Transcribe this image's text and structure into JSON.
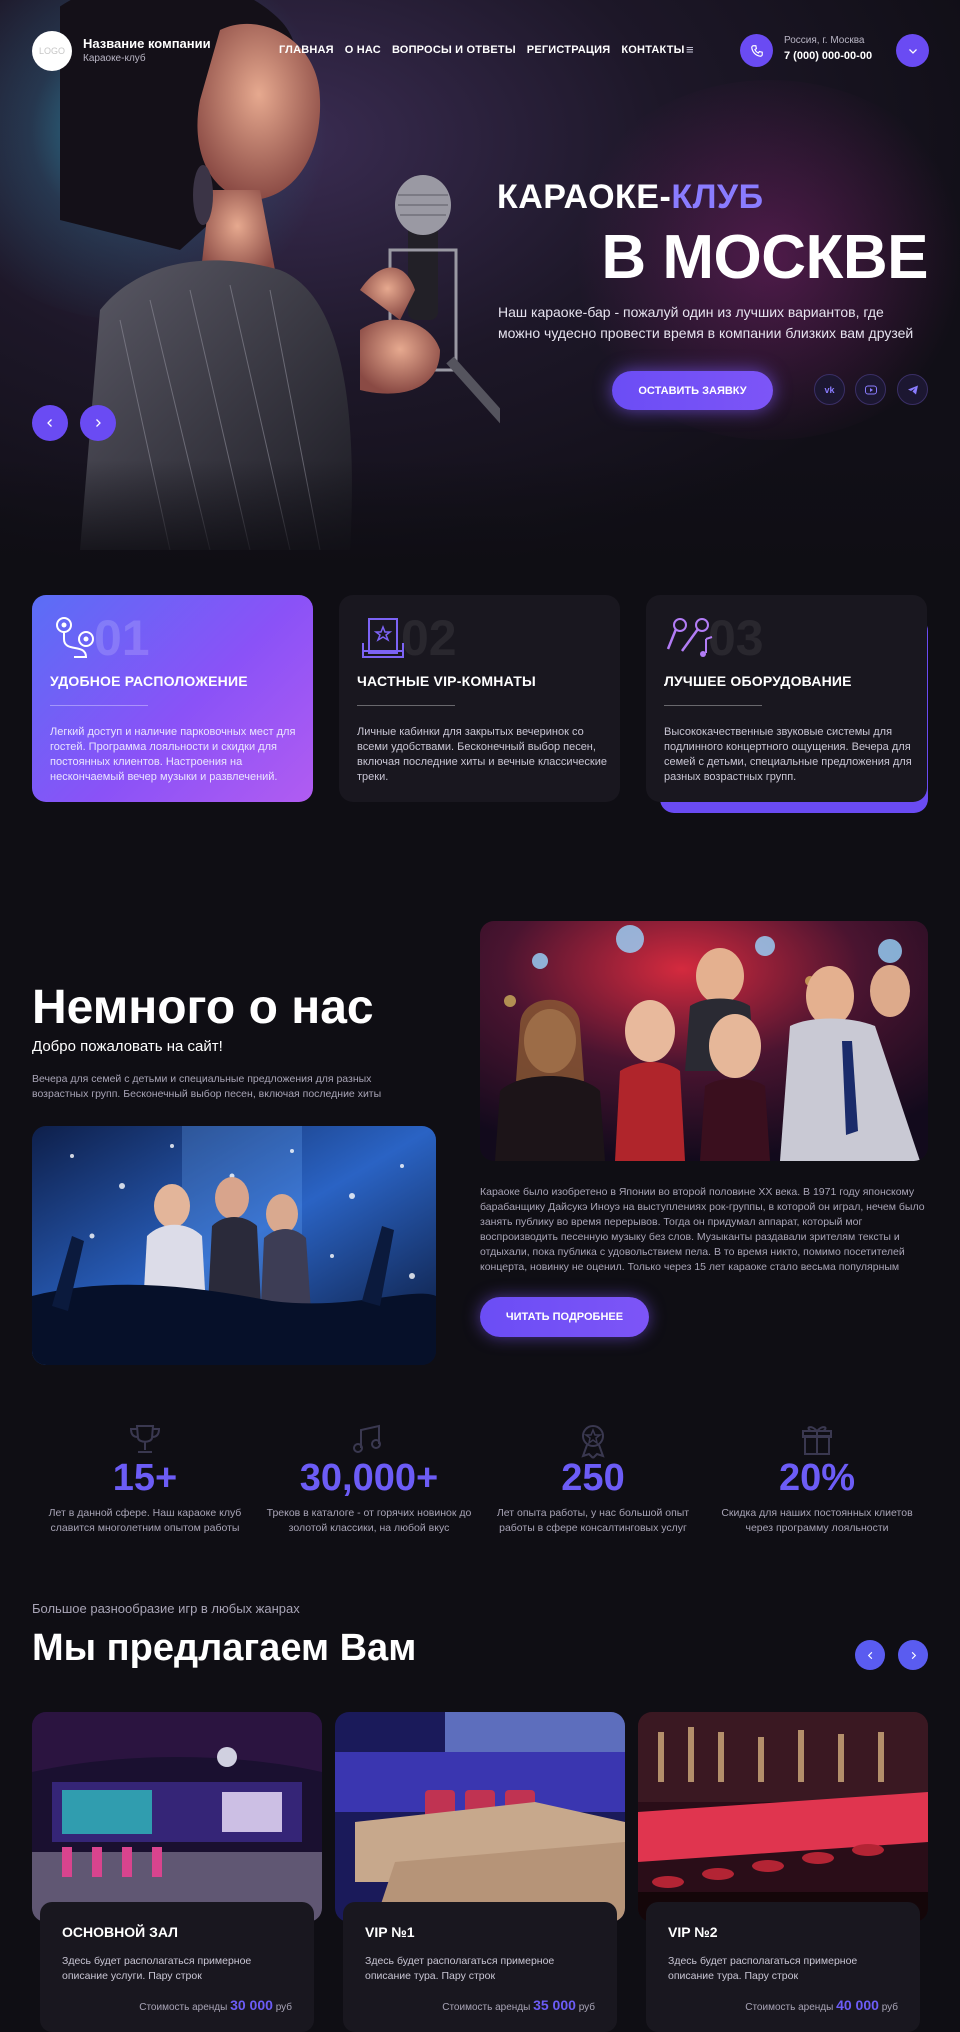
{
  "header": {
    "logo": "LOGO",
    "company": "Название компании",
    "company_sub": "Караоке-клуб",
    "nav": [
      "ГЛАВНАЯ",
      "О НАС",
      "ВОПРОСЫ И ОТВЕТЫ",
      "РЕГИСТРАЦИЯ",
      "КОНТАКТЫ"
    ],
    "menu_icon": "≡",
    "address": "Россия, г. Москва",
    "phone": "7 (000) 000-00-00"
  },
  "hero": {
    "title1_a": "КАРАОКЕ-",
    "title1_b": "КЛУБ",
    "title2": "В МОСКВЕ",
    "desc": "Наш караоке-бар - пожалуй один из лучших вариантов, где можно чудесно провести время в компании близких вам друзей",
    "cta": "ОСТАВИТЬ ЗАЯВКУ",
    "social": [
      "vk",
      "youtube",
      "telegram"
    ]
  },
  "features": [
    {
      "num": "01",
      "title": "УДОБНОЕ РАСПОЛОЖЕНИЕ",
      "text": "Легкий доступ и наличие парковочных мест для гостей. Программа лояльности и скидки для постоянных клиентов.  Настроения на нескончаемый вечер музыки и развлечений."
    },
    {
      "num": "02",
      "title": "ЧАСТНЫЕ VIP-КОМНАТЫ",
      "text": "Личные кабинки для закрытых вечеринок со всеми удобствами. Бесконечный выбор песен, включая последние хиты и вечные классические треки."
    },
    {
      "num": "03",
      "title": "ЛУЧШЕЕ ОБОРУДОВАНИЕ",
      "text": "Высококачественные звуковые системы для подлинного концертного ощущения. Вечера для семей с детьми, специальные предложения для разных возрастных групп."
    }
  ],
  "about": {
    "title": "Немного о нас",
    "subtitle": "Добро пожаловать на сайт!",
    "text1": "Вечера для семей с детьми и специальные предложения для разных возрастных групп. Бесконечный выбор песен, включая последние хиты",
    "text2": "Караоке было изобретено в Японии во второй половине XX века. В 1971 году японскому барабанщику Дайсукэ Иноуэ на выступлениях рок-группы, в которой он играл, нечем было занять публику во время перерывов. Тогда он придумал аппарат, который мог воспроизводить песенную музыку без слов. Музыканты раздавали зрителям тексты и отдыхали, пока публика с удовольствием пела. В то время никто, помимо посетителей концерта, новинку не оценил. Только через 15 лет караоке стало весьма популярным",
    "button": "ЧИТАТЬ ПОДРОБНЕЕ"
  },
  "stats": [
    {
      "value": "15+",
      "text": "Лет в данной сфере. Наш караоке клуб славится многолетним опытом работы",
      "icon": "trophy-icon"
    },
    {
      "value": "30,000+",
      "text": "Треков в каталоге - от горячих новинок до золотой классики, на любой вкус",
      "icon": "music-notes-icon"
    },
    {
      "value": "250",
      "text": "Лет опыта работы, у нас большой опыт работы в сфере консалтинговых услуг",
      "icon": "medal-icon"
    },
    {
      "value": "20%",
      "text": "Скидка для наших постоянных клиетов через программу лояльности",
      "icon": "gift-icon"
    }
  ],
  "offers": {
    "pre": "Большое разнообразие игр в любых жанрах",
    "title": "Мы предлагаем Вам",
    "cards": [
      {
        "title": "ОСНОВНОЙ ЗАЛ",
        "text": "Здесь будет располагаться примерное описание услуги. Пару строк",
        "price_label": "Стоимость аренды",
        "price": "30 000",
        "unit": "руб"
      },
      {
        "title": "VIP №1",
        "text": "Здесь будет располагаться примерное описание тура. Пару строк",
        "price_label": "Стоимость аренды",
        "price": "35 000",
        "unit": "руб"
      },
      {
        "title": "VIP №2",
        "text": "Здесь будет располагаться примерное описание тура. Пару строк",
        "price_label": "Стоимость аренды",
        "price": "40 000",
        "unit": "руб"
      }
    ]
  },
  "colors": {
    "accent": "#6a4bf3",
    "background": "#0f0e14",
    "card": "#19171f",
    "stat": "#6c5cf6"
  }
}
